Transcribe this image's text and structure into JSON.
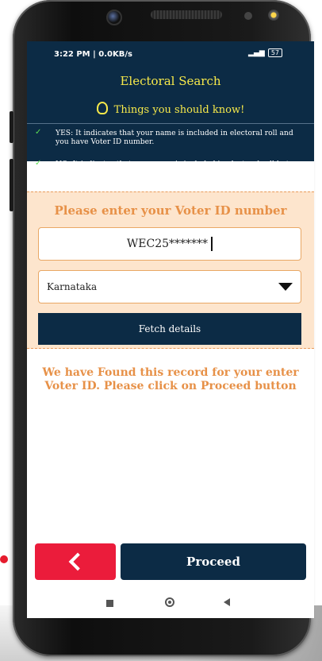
{
  "status_bar": {
    "time": "3:22 PM | 0.0KB/s",
    "battery": "57"
  },
  "header": {
    "title": "Electoral Search",
    "info_title": "Things you should know!",
    "items": [
      {
        "text": "YES: It indicates that your name is included in electoral roll and you have Voter ID number."
      },
      {
        "text": "NO: It indicates that your name is included in electoral roll but you don't have Voter ID number."
      }
    ]
  },
  "form": {
    "title": "Please enter your Voter ID number",
    "voter_id_value": "WEC25*******",
    "state_value": "Karnataka",
    "fetch_label": "Fetch details"
  },
  "result_message": "We have Found this record for your enter Voter ID. Please click on Proceed button",
  "actions": {
    "proceed_label": "Proceed"
  },
  "colors": {
    "primary": "#0c2b45",
    "accent": "#f7e94a",
    "orange": "#e79148",
    "danger": "#eb1c3b"
  }
}
